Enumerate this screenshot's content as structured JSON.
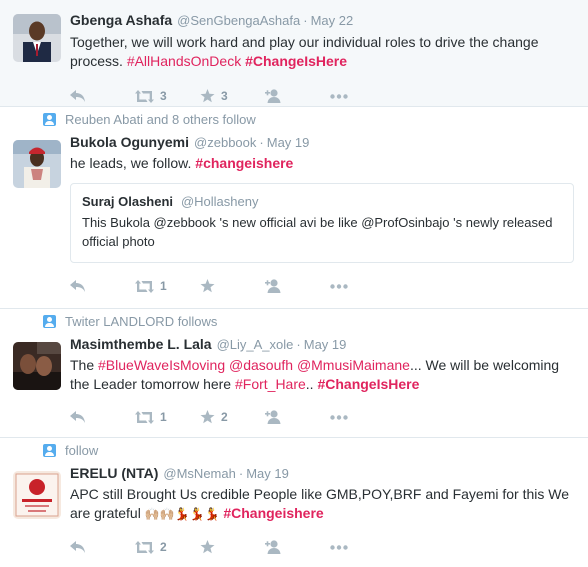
{
  "tweets": [
    {
      "context": "",
      "name": "Gbenga Ashafa",
      "handle": "@SenGbengaAshafa",
      "dot": "·",
      "time": "May 22",
      "text_parts": [
        "Together, we will work hard and play our individual roles to drive the change process. ",
        "#AllHandsOnDeck",
        " ",
        "#ChangeIsHere"
      ],
      "retweets": "3",
      "favorites": "3"
    },
    {
      "context": "Reuben Abati and 8 others follow",
      "name": "Bukola Ogunyemi",
      "handle": "@zebbook",
      "dot": "·",
      "time": "May 19",
      "text_parts": [
        "he leads, we follow. ",
        "#changeishere"
      ],
      "quote": {
        "name": "Suraj Olasheni",
        "handle": "@Hollasheny",
        "text": "This Bukola @zebbook 's new official avi be like @ProfOsinbajo 's newly released official photo"
      },
      "retweets": "1",
      "favorites": ""
    },
    {
      "context": "Twiter LANDLORD follows",
      "name": "Masimthembe L. Lala",
      "handle": "@Liy_A_xole",
      "dot": "·",
      "time": "May 19",
      "text_parts": [
        "The ",
        "#BlueWaveIsMoving",
        " ",
        "@dasoufh",
        " ",
        "@MmusiMaimane",
        "... We will be welcoming the Leader tomorrow here ",
        "#Fort_Hare",
        ".. ",
        "#ChangeIsHere"
      ],
      "retweets": "1",
      "favorites": "2"
    },
    {
      "context": "follow",
      "name": "ERELU (NTA)",
      "handle": "@MsNemah",
      "dot": "·",
      "time": "May 19",
      "text_parts": [
        "APC still Brought Us credible People like GMB,POY,BRF and Fayemi for this We are grateful ",
        "🙌🏼🙌🏼💃💃💃",
        " ",
        "#Changeishere"
      ],
      "retweets": "2",
      "favorites": ""
    }
  ],
  "icons": {
    "reply": "reply-icon",
    "retweet": "retweet-icon",
    "favorite": "star-icon",
    "follow": "follow-icon",
    "more": "more-icon",
    "social_context": "person-icon"
  },
  "colors": {
    "hashtag": "#e0245e",
    "meta": "#8899a6",
    "action": "#aab8c2",
    "context_icon": "#55acee",
    "border": "#e1e8ed"
  }
}
